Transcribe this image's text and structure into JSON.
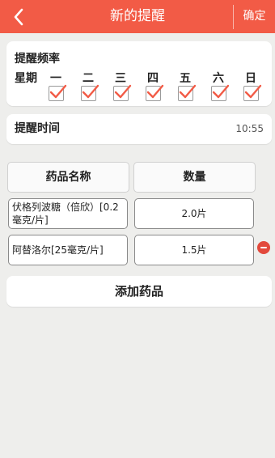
{
  "header": {
    "title": "新的提醒",
    "confirm_label": "确定",
    "accent_color": "#f25b46"
  },
  "frequency": {
    "title": "提醒频率",
    "week_label": "星期",
    "days": [
      {
        "label": "一",
        "checked": true
      },
      {
        "label": "二",
        "checked": true
      },
      {
        "label": "三",
        "checked": true
      },
      {
        "label": "四",
        "checked": true
      },
      {
        "label": "五",
        "checked": true
      },
      {
        "label": "六",
        "checked": true
      },
      {
        "label": "日",
        "checked": true
      }
    ]
  },
  "reminder_time": {
    "label": "提醒时间",
    "value": "10:55"
  },
  "medicine_table": {
    "name_header": "药品名称",
    "quantity_header": "数量",
    "rows": [
      {
        "name": "伏格列波糖（倍欣）[0.2毫克/片]",
        "quantity": "2.0片"
      },
      {
        "name": "阿替洛尔[25毫克/片]",
        "quantity": "1.5片"
      }
    ]
  },
  "add_medicine_label": "添加药品"
}
